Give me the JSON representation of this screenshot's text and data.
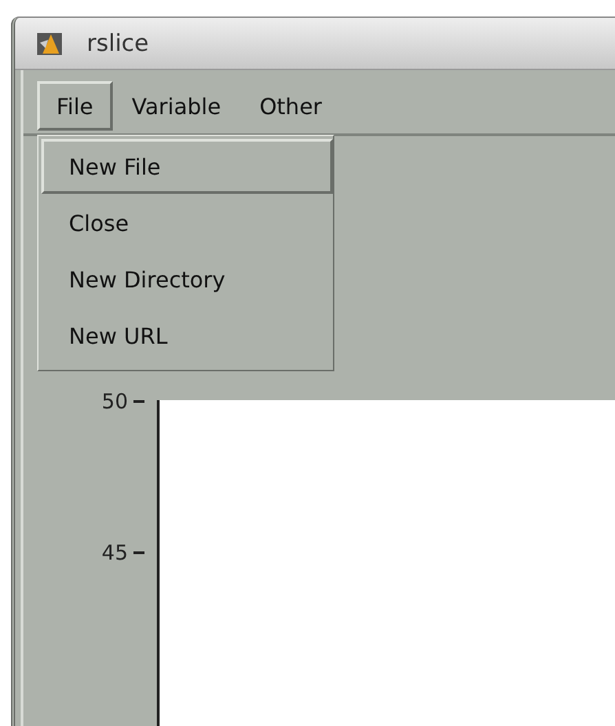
{
  "window": {
    "title": "rslice"
  },
  "menu_bar": [
    {
      "label": "File",
      "selected": true
    },
    {
      "label": "Variable",
      "selected": false
    },
    {
      "label": "Other",
      "selected": false
    }
  ],
  "file_menu": [
    {
      "label": "New File",
      "selected": true
    },
    {
      "label": "Close",
      "selected": false
    },
    {
      "label": "New Directory",
      "selected": false
    },
    {
      "label": "New URL",
      "selected": false
    }
  ],
  "plot": {
    "y_ticks": [
      "50",
      "45"
    ]
  }
}
